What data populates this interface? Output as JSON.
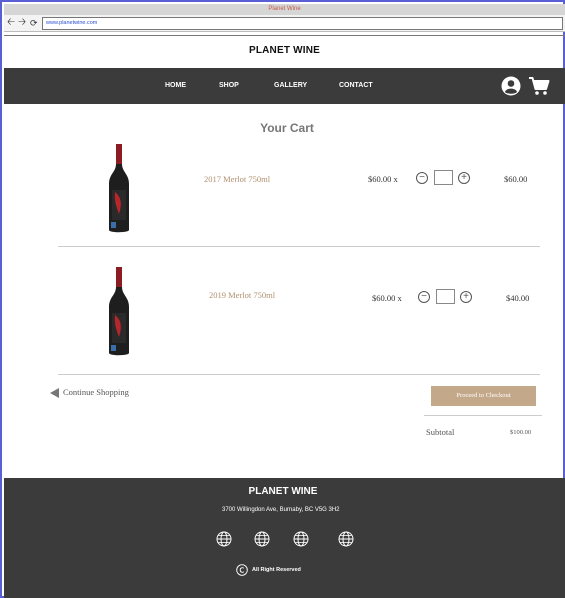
{
  "browser": {
    "window_title": "Planet Wine",
    "url": "www.planetwine.com",
    "back_icon": "arrow-left-icon",
    "forward_icon": "arrow-right-icon",
    "reload_icon": "reload-icon"
  },
  "header": {
    "brand": "PLANET WINE",
    "nav": [
      "HOME",
      "SHOP",
      "GALLERY",
      "CONTACT"
    ],
    "account_icon": "user-circle-icon",
    "cart_icon": "shopping-cart-icon",
    "bg_color": "#3b3b3b"
  },
  "cart": {
    "title": "Your Cart",
    "items": [
      {
        "name": "2017 Merlot 750ml",
        "unit_price": "$60.00 x",
        "total": "$60.00"
      },
      {
        "name": "2019 Merlot 750ml",
        "unit_price": "$60.00 x",
        "total": "$40.00"
      }
    ],
    "minus_icon": "minus-circle-icon",
    "plus_icon": "plus-circle-icon",
    "continue_label": "Continue Shopping",
    "checkout_label": "Proceed to Checkout",
    "subtotal_label": "Subtotal",
    "subtotal_value": "$100.00",
    "accent_color": "#c4a88a"
  },
  "footer": {
    "brand": "PLANET WINE",
    "address": "3700 Willingdon Ave, Burnaby, BC V5G 3H2",
    "social_icons": [
      "globe-icon",
      "globe-icon",
      "globe-icon",
      "globe-icon"
    ],
    "copyright_icon": "copyright-icon",
    "rights": "All Right Reserved"
  }
}
